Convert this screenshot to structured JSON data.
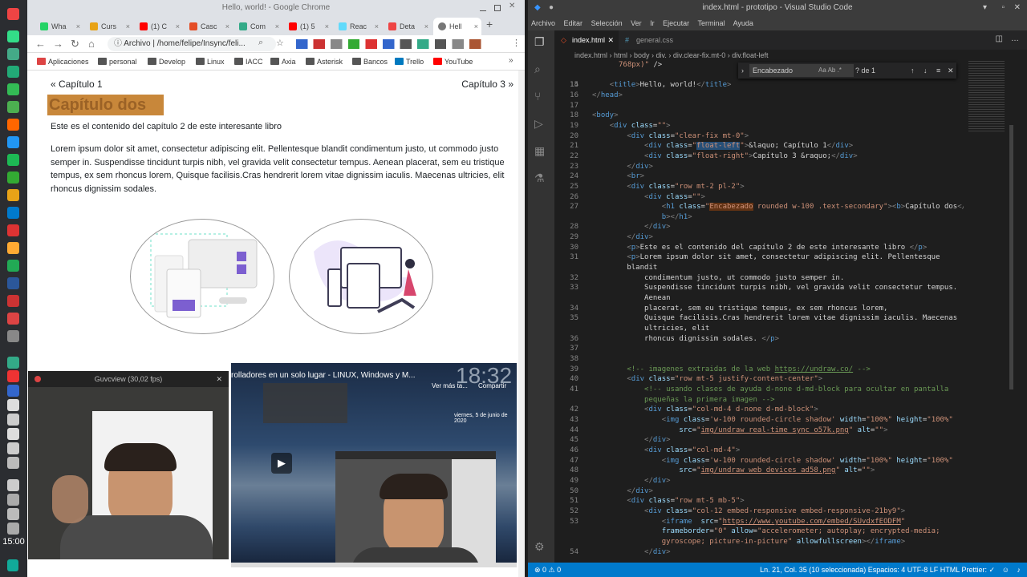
{
  "dock": {
    "time": "15:00"
  },
  "chrome": {
    "window_title": "Hello, world! - Google Chrome",
    "tabs": [
      "Wha",
      "Curs",
      "(1) C",
      "Casc",
      "Com",
      "(1) 5",
      "Reac",
      "Deta",
      "Hell"
    ],
    "url_prefix": "Archivo",
    "url": "/home/felipe/Insync/feli...",
    "bookmarks": [
      "Aplicaciones",
      "personal",
      "Develop",
      "Linux",
      "IACC",
      "Axia",
      "Asterisk",
      "Bancos",
      "Trello",
      "YouTube"
    ],
    "page": {
      "prev_link": "« Capítulo 1",
      "next_link": "Capítulo 3 »",
      "heading": "Capítulo dos",
      "p1": "Este es el contenido del capítulo 2 de este interesante libro",
      "p2": "Lorem ipsum dolor sit amet, consectetur adipiscing elit. Pellentesque blandit condimentum justo, ut commodo justo semper in. Suspendisse tincidunt turpis nibh, vel gravida velit consectetur tempus. Aenean placerat, sem eu tristique tempus, ex sem rhoncus lorem, Quisque facilisis.Cras hendrerit lorem vitae dignissim iaculis. Maecenas ultricies, elit rhoncus dignissim sodales."
    }
  },
  "guvcview": {
    "title": "Guvcview (30,02 fps)"
  },
  "youtube": {
    "title": "rolladores en un solo lugar - LINUX, Windows y M...",
    "clock": "18:32",
    "watch_later": "Ver más ta...",
    "share": "Compartir",
    "date": "viernes, 5 de junio de 2020"
  },
  "vscode": {
    "window_title": "index.html - prototipo - Visual Studio Code",
    "menu": [
      "Archivo",
      "Editar",
      "Selección",
      "Ver",
      "Ir",
      "Ejecutar",
      "Terminal",
      "Ayuda"
    ],
    "tabs": [
      "index.html",
      "general.css"
    ],
    "breadcrumb": "index.html › html › body › div. › div.clear-fix.mt-0 › div.float-left",
    "find_value": "Encabezado",
    "find_opts": "Aa  Ab  .*",
    "find_count": "? de 1",
    "status_left": "⊗ 0  ⚠ 0",
    "status_right": "Ln. 21, Col. 35 (10 seleccionada)   Espacios: 4   UTF-8   LF   HTML   Prettier: ✓"
  }
}
